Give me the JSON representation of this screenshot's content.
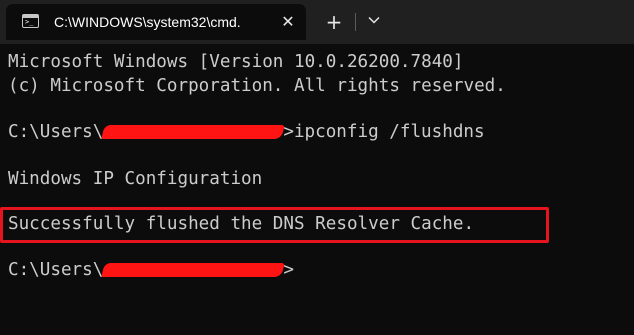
{
  "window": {
    "tab_title": "C:\\WINDOWS\\system32\\cmd.",
    "tab_icon": "terminal-icon",
    "close_symbol": "✕",
    "new_tab_symbol": "+",
    "dropdown_icon": "chevron-down-icon"
  },
  "terminal": {
    "header_line_1": "Microsoft Windows [Version 10.0.26200.7840]",
    "header_line_2": "(c) Microsoft Corporation. All rights reserved.",
    "prompt_prefix_1": "C:\\Users\\",
    "prompt_suffix_1": ">",
    "command": "ipconfig /flushdns",
    "output_line_1": "Windows IP Configuration",
    "output_line_2": "Successfully flushed the DNS Resolver Cache.",
    "prompt_prefix_2": "C:\\Users\\",
    "prompt_suffix_2": ">"
  },
  "colors": {
    "background": "#0c0c0c",
    "titlebar": "#202020",
    "text": "#cccccc",
    "highlight": "#e6141e",
    "redaction": "#ff1414"
  }
}
